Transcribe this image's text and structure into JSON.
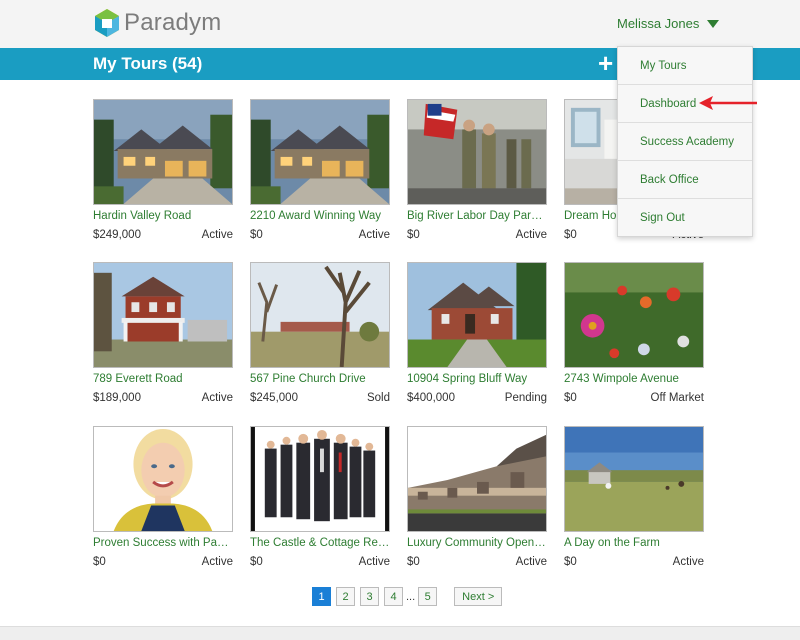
{
  "header": {
    "logo_text": "Paradym",
    "user_name": "Melissa Jones"
  },
  "titlebar": {
    "title": "My Tours (54)",
    "add_label": "+"
  },
  "dropdown": {
    "items": [
      "My Tours",
      "Dashboard",
      "Success Academy",
      "Back Office",
      "Sign Out"
    ]
  },
  "tours": [
    {
      "title": "Hardin Valley Road",
      "price": "$249,000",
      "status": "Active",
      "image": "house-night-1"
    },
    {
      "title": "2210 Award Winning Way",
      "price": "$0",
      "status": "Active",
      "image": "house-night-2"
    },
    {
      "title": "Big River Labor Day Para…",
      "price": "$0",
      "status": "Active",
      "image": "parade"
    },
    {
      "title": "Dream Home",
      "price": "$0",
      "status": "Active",
      "image": "kitchen"
    },
    {
      "title": "789 Everett Road",
      "price": "$189,000",
      "status": "Active",
      "image": "red-house"
    },
    {
      "title": "567 Pine Church Drive",
      "price": "$245,000",
      "status": "Sold",
      "image": "tree-yard"
    },
    {
      "title": "10904 Spring Bluff Way",
      "price": "$400,000",
      "status": "Pending",
      "image": "brick-house"
    },
    {
      "title": "2743 Wimpole Avenue",
      "price": "$0",
      "status": "Off Market",
      "image": "flowers"
    },
    {
      "title": "Proven Success with Past…",
      "price": "$0",
      "status": "Active",
      "image": "woman-portrait"
    },
    {
      "title": "The Castle & Cottage Re…",
      "price": "$0",
      "status": "Active",
      "image": "business-team"
    },
    {
      "title": "Luxury Community Openi…",
      "price": "$0",
      "status": "Active",
      "image": "townhomes"
    },
    {
      "title": "A Day on the Farm",
      "price": "$0",
      "status": "Active",
      "image": "farm"
    }
  ],
  "pagination": {
    "pages": [
      "1",
      "2",
      "3",
      "4",
      "5"
    ],
    "current": "1",
    "ellipsis": "...",
    "next_label": "Next >"
  },
  "colors": {
    "brand_blue": "#1a9dc2",
    "link_green": "#2e7d32",
    "active_page": "#1a7fd6",
    "annotation_arrow": "#e5222a"
  }
}
